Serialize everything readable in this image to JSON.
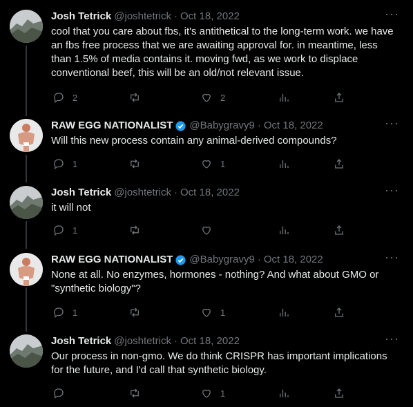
{
  "tweets": [
    {
      "name": "Josh Tetrick",
      "handle": "@joshtetrick",
      "date": "Oct 18, 2022",
      "verified": false,
      "text": "cool that you care about fbs, it's antithetical to the long-term work. we have an fbs free process that we are awaiting approval for. in meantime, less than 1.5% of media contains it. moving fwd, as we work to displace conventional beef, this will be an old/not relevant issue.",
      "replies": "2",
      "retweets": "",
      "likes": "2"
    },
    {
      "name": "RAW EGG NATIONALIST",
      "handle": "@Babygravy9",
      "date": "Oct 18, 2022",
      "verified": true,
      "text": "Will this new process contain any animal-derived compounds?",
      "replies": "1",
      "retweets": "",
      "likes": "1"
    },
    {
      "name": "Josh Tetrick",
      "handle": "@joshtetrick",
      "date": "Oct 18, 2022",
      "verified": false,
      "text": "it will not",
      "replies": "1",
      "retweets": "",
      "likes": ""
    },
    {
      "name": "RAW EGG NATIONALIST",
      "handle": "@Babygravy9",
      "date": "Oct 18, 2022",
      "verified": true,
      "text": "None at all. No enzymes, hormones - nothing? And what about GMO or \"synthetic biology\"?",
      "replies": "1",
      "retweets": "",
      "likes": "1"
    },
    {
      "name": "Josh Tetrick",
      "handle": "@joshtetrick",
      "date": "Oct 18, 2022",
      "verified": false,
      "text": "Our process in non-gmo. We do think CRISPR has important implications for the future, and I'd call that synthetic biology.",
      "replies": "",
      "retweets": "",
      "likes": "1"
    }
  ],
  "separator": "·",
  "more_glyph": "···",
  "colors": {
    "background": "#000000",
    "text": "#e7e9ea",
    "muted": "#71767b",
    "verified": "#1d9bf0",
    "thread_line": "#333639"
  },
  "icons": [
    "reply-icon",
    "retweet-icon",
    "like-icon",
    "views-icon",
    "share-icon",
    "verified-badge-icon",
    "more-icon"
  ]
}
